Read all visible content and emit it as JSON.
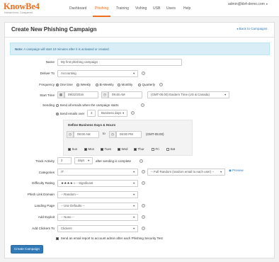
{
  "brand": {
    "logo": "KnowBe4",
    "tagline": "Human error. Conquered.",
    "accent": "#ef6e1f"
  },
  "nav": {
    "items": [
      "Dashboard",
      "Phishing",
      "Training",
      "Vishing",
      "USB",
      "Users",
      "Help"
    ],
    "active": "Phishing"
  },
  "user": {
    "email": "admin@kb4-demo.com"
  },
  "page": {
    "title": "Create New Phishing Campaign",
    "back_link": "Back to Campaigns"
  },
  "note": {
    "label": "Note:",
    "text": "A campaign will start 10 minutes after it is activated or created."
  },
  "form": {
    "name_label": "Name",
    "name_value": "My first phishing campaign",
    "deliver_label": "Deliver To",
    "deliver_value": "Accounting",
    "frequency_label": "Frequency",
    "frequency_options": [
      "One time",
      "Weekly",
      "Bi-Weekly",
      "Monthly",
      "Quarterly"
    ],
    "frequency_selected": "One time",
    "start_label": "Start Time",
    "start_date": "09/22/2016",
    "start_time": "09:46 AM",
    "timezone": "(GMT-05:00) Eastern Time (US & Canada)",
    "sending_label": "Sending",
    "send_all_label": "Send all emails when the campaign starts",
    "send_over_label": "Send emails over",
    "send_over_count": "3",
    "send_over_unit": "Business days",
    "biz_title": "Define Business Days & Hours",
    "biz_start": "09:00 AM",
    "biz_to": "to",
    "biz_end": "05:00 PM",
    "biz_tz": "(GMT-05:00)",
    "days": [
      {
        "name": "Sun",
        "checked": true
      },
      {
        "name": "Mon",
        "checked": true
      },
      {
        "name": "Tues",
        "checked": true
      },
      {
        "name": "Wed",
        "checked": true
      },
      {
        "name": "Thur",
        "checked": true
      },
      {
        "name": "Fri",
        "checked": false
      },
      {
        "name": "Sat",
        "checked": false
      }
    ],
    "track_label": "Track Activity",
    "track_count": "2",
    "track_unit": "days",
    "track_suffix": "after sending is complete",
    "categories_label": "Categories",
    "categories_value": "IT",
    "random_value": "-- Full Random (random email to each user) --",
    "preview_label": "Preview",
    "difficulty_label": "Difficulty Rating",
    "difficulty_stars": "★★★★☆",
    "difficulty_value": "- Significant",
    "phish_domain_label": "Phish Link Domain",
    "phish_domain_value": "-- Random --",
    "landing_label": "Landing Page",
    "landing_value": "-- Use Defaults --",
    "exploit_label": "Add Exploit",
    "exploit_value": "-- None --",
    "clickers_label": "Add Clickers To",
    "clickers_value": "Clickers",
    "report_label": "Send an email report to account admin after each Phishing Security Test"
  },
  "submit_label": "Create Campaign",
  "colors": {
    "primary": "#3279b7",
    "link": "#2f7ab9",
    "note_bg": "#d9edf7"
  }
}
